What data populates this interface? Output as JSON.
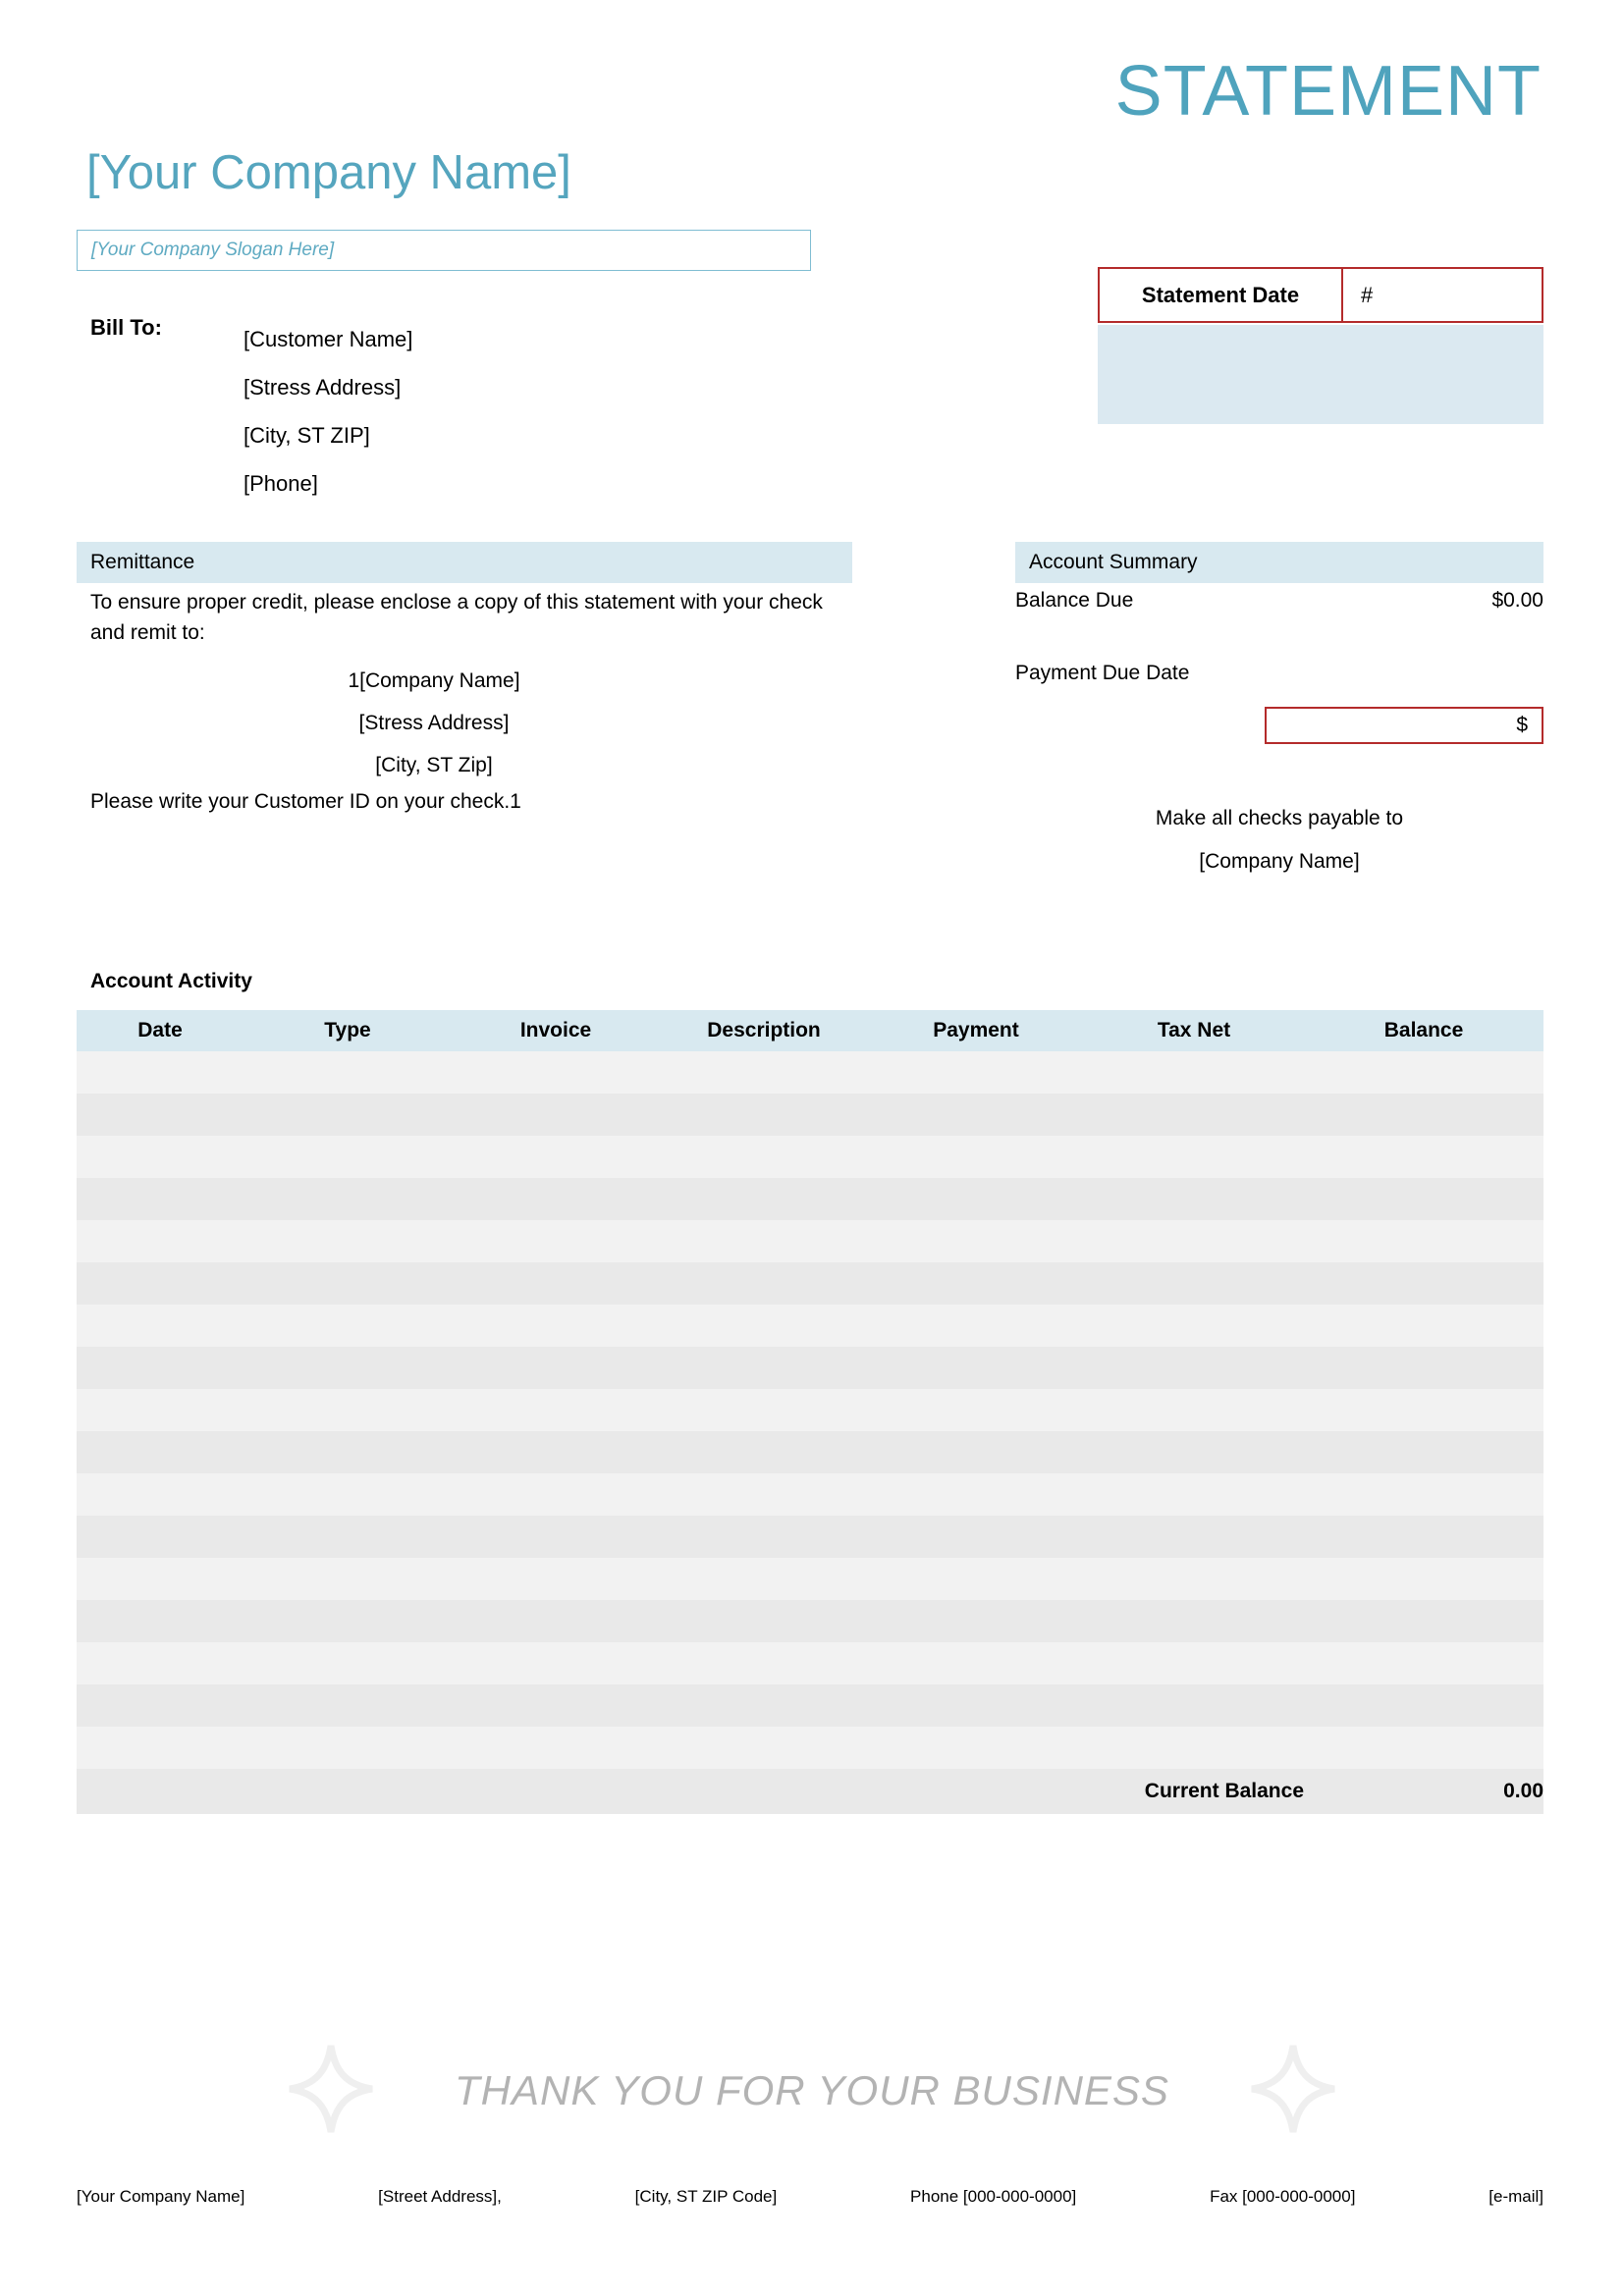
{
  "document": {
    "title": "STATEMENT",
    "company_name": "[Your Company Name]",
    "company_slogan": "[Your Company Slogan Here]"
  },
  "colors": {
    "brand_teal": "#55a5be",
    "band_blue": "#d8e9f0",
    "box_blue": "#dbe9f1",
    "accent_red": "#b42b2b",
    "row_light": "#f2f2f2",
    "row_dark": "#e9e9e9",
    "thankyou_gray": "#b3b3b3"
  },
  "statement_date": {
    "label": "Statement Date",
    "value": "#"
  },
  "bill_to": {
    "label": "Bill To:",
    "lines": [
      "[Customer Name]",
      "[Stress Address]",
      "[City, ST ZIP]",
      "[Phone]"
    ]
  },
  "remittance": {
    "heading": "Remittance",
    "intro": "To ensure proper credit, please enclose a copy of this statement with your check and remit to:",
    "address_lines": [
      "1[Company Name]",
      "[Stress Address]",
      "[City, ST Zip]"
    ],
    "note": "Please write your Customer ID on your check.1"
  },
  "account_summary": {
    "heading": "Account Summary",
    "balance_due_label": "Balance Due",
    "balance_due_value": "$0.00",
    "payment_due_date_label": "Payment Due Date",
    "payment_due_date_value": "",
    "payment_amount_symbol": "$",
    "payment_amount_value": "",
    "checks_payable_line1": "Make all checks payable to",
    "checks_payable_line2": "[Company Name]"
  },
  "account_activity": {
    "title": "Account Activity",
    "columns": [
      "Date",
      "Type",
      "Invoice",
      "Description",
      "Payment",
      "Tax Net",
      "Balance"
    ],
    "rows": [
      [
        "",
        "",
        "",
        "",
        "",
        "",
        ""
      ],
      [
        "",
        "",
        "",
        "",
        "",
        "",
        ""
      ],
      [
        "",
        "",
        "",
        "",
        "",
        "",
        ""
      ],
      [
        "",
        "",
        "",
        "",
        "",
        "",
        ""
      ],
      [
        "",
        "",
        "",
        "",
        "",
        "",
        ""
      ],
      [
        "",
        "",
        "",
        "",
        "",
        "",
        ""
      ],
      [
        "",
        "",
        "",
        "",
        "",
        "",
        ""
      ],
      [
        "",
        "",
        "",
        "",
        "",
        "",
        ""
      ],
      [
        "",
        "",
        "",
        "",
        "",
        "",
        ""
      ],
      [
        "",
        "",
        "",
        "",
        "",
        "",
        ""
      ],
      [
        "",
        "",
        "",
        "",
        "",
        "",
        ""
      ],
      [
        "",
        "",
        "",
        "",
        "",
        "",
        ""
      ],
      [
        "",
        "",
        "",
        "",
        "",
        "",
        ""
      ],
      [
        "",
        "",
        "",
        "",
        "",
        "",
        ""
      ],
      [
        "",
        "",
        "",
        "",
        "",
        "",
        ""
      ],
      [
        "",
        "",
        "",
        "",
        "",
        "",
        ""
      ],
      [
        "",
        "",
        "",
        "",
        "",
        "",
        ""
      ]
    ],
    "total_label": "Current Balance",
    "total_value": "0.00"
  },
  "thank_you": {
    "message": "THANK YOU FOR YOUR BUSINESS",
    "left_icon": "sparkle-icon",
    "right_icon": "sparkle-icon"
  },
  "footer": {
    "items": [
      "[Your Company Name]",
      "[Street Address],",
      "[City, ST ZIP Code]",
      "Phone [000-000-0000]",
      "Fax [000-000-0000]",
      "[e-mail]"
    ]
  }
}
